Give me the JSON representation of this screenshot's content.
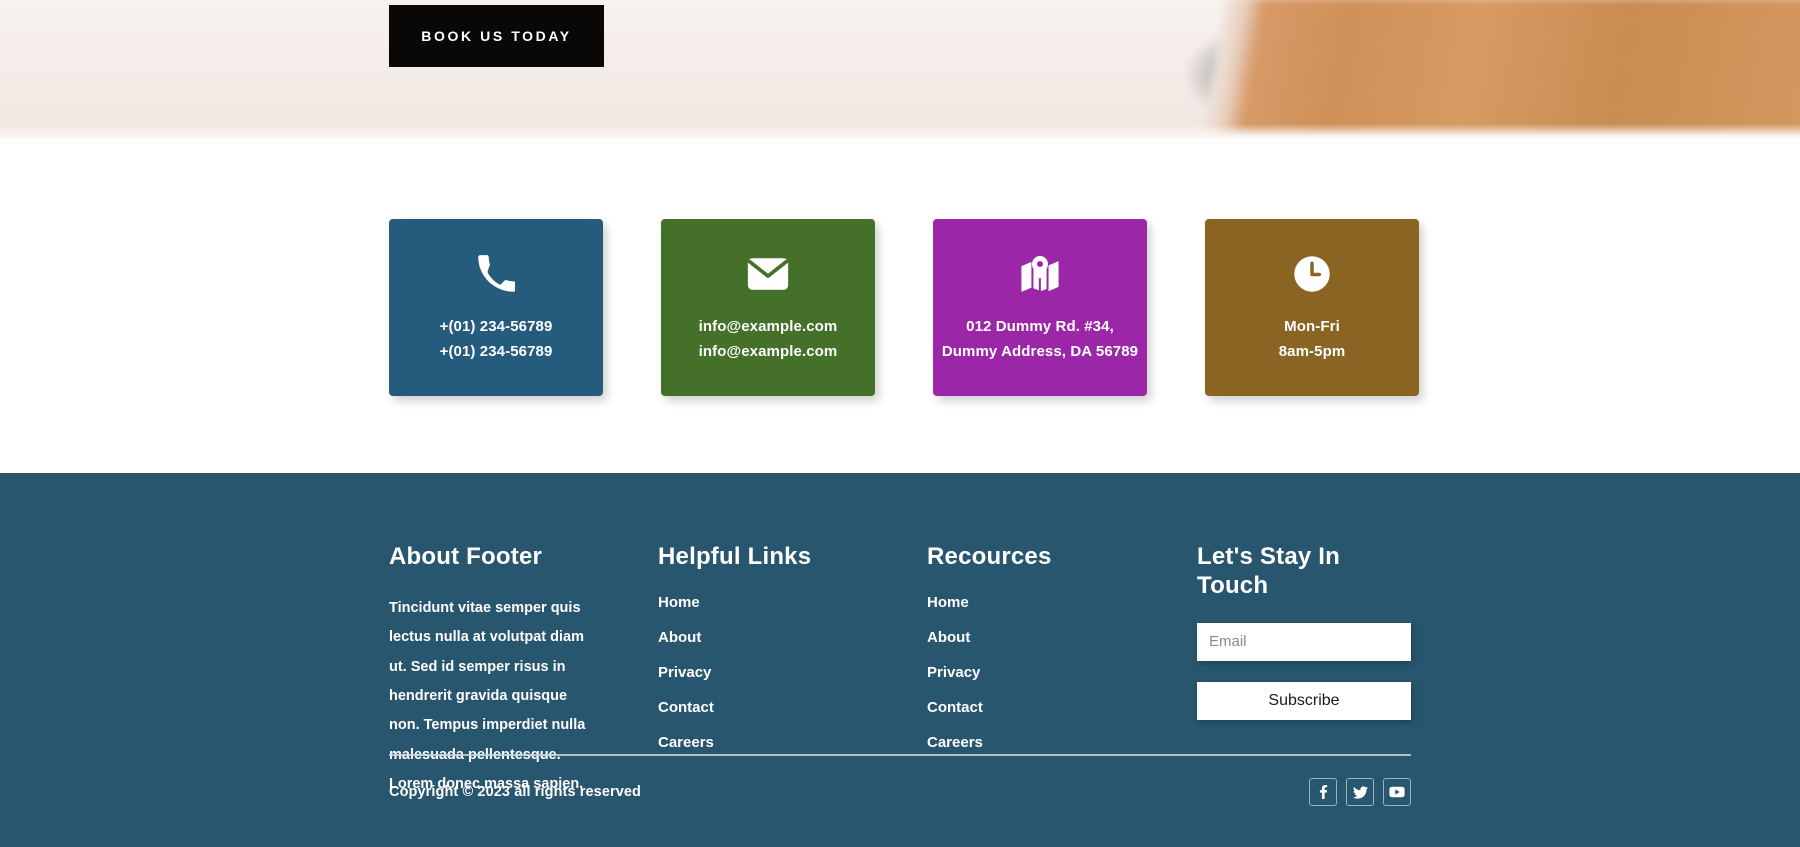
{
  "hero": {
    "cta_label": "BOOK US TODAY",
    "background_description": "blurred-desk-photo"
  },
  "info_cards": [
    {
      "icon": "phone-icon",
      "color": "#255C7E",
      "lines": [
        "+(01) 234-56789",
        "+(01) 234-56789"
      ]
    },
    {
      "icon": "envelope-icon",
      "color": "#45702A",
      "lines": [
        "info@example.com",
        "info@example.com"
      ]
    },
    {
      "icon": "map-pin-icon",
      "color": "#9B27A8",
      "lines": [
        "012 Dummy Rd. #34,",
        "Dummy Address, DA 56789"
      ]
    },
    {
      "icon": "clock-icon",
      "color": "#8A6422",
      "lines": [
        "Mon-Fri",
        "8am-5pm"
      ]
    }
  ],
  "footer": {
    "background_color": "#28566F",
    "about": {
      "heading": "About Footer",
      "text": "Tincidunt vitae semper quis lectus nulla at volutpat diam ut. Sed id semper risus in hendrerit gravida quisque non. Tempus imperdiet nulla malesuada pellentesque. Lorem donec massa sapien."
    },
    "helpful_links": {
      "heading": "Helpful Links",
      "items": [
        "Home",
        "About",
        "Privacy",
        "Contact",
        "Careers"
      ]
    },
    "resources": {
      "heading": "Recources",
      "items": [
        "Home",
        "About",
        "Privacy",
        "Contact",
        "Careers"
      ]
    },
    "newsletter": {
      "heading": "Let's Stay In Touch",
      "email_placeholder": "Email",
      "email_value": "",
      "subscribe_label": "Subscribe"
    },
    "copyright": "Copyright © 2023 all rights reserved",
    "socials": [
      {
        "name": "facebook-icon",
        "label": "f"
      },
      {
        "name": "twitter-icon",
        "label": "twitter"
      },
      {
        "name": "youtube-icon",
        "label": "youtube"
      }
    ]
  }
}
